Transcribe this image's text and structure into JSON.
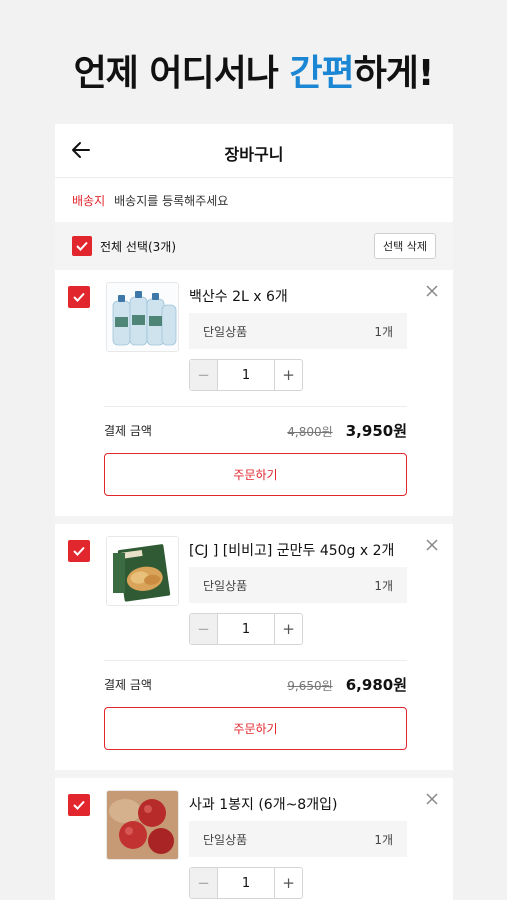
{
  "headline": {
    "part1": "언제 어디서나 ",
    "accent": "간편",
    "part2": "하게!"
  },
  "header": {
    "title": "장바구니"
  },
  "shipping": {
    "label": "배송지",
    "message": "배송지를 등록해주세요"
  },
  "selection": {
    "all_label": "전체 선택(3개)",
    "delete_label": "선택 삭제"
  },
  "colors": {
    "accent_red": "#e2262e",
    "headline_blue": "#1a86d4"
  },
  "items": [
    {
      "name": "백산수 2L x 6개",
      "option_label": "단일상품",
      "option_qty": "1개",
      "quantity": "1",
      "pay_label": "결제 금액",
      "original_price": "4,800원",
      "final_price": "3,950원",
      "order_label": "주문하기",
      "image": "water-bottles"
    },
    {
      "name": "[CJ ] [비비고] 군만두 450g x 2개",
      "option_label": "단일상품",
      "option_qty": "1개",
      "quantity": "1",
      "pay_label": "결제 금액",
      "original_price": "9,650원",
      "final_price": "6,980원",
      "order_label": "주문하기",
      "image": "dumpling-package"
    },
    {
      "name": "사과 1봉지 (6개~8개입)",
      "option_label": "단일상품",
      "option_qty": "1개",
      "quantity": "1",
      "image": "apples"
    }
  ]
}
